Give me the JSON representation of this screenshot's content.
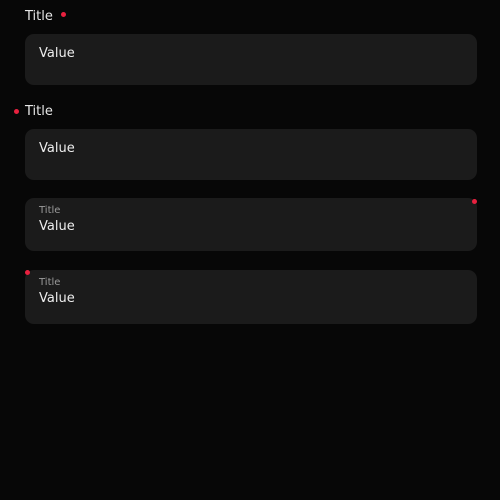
{
  "fields": [
    {
      "title": "Title",
      "value": "Value",
      "required": true,
      "layout": "outside-label-dot-after"
    },
    {
      "title": "Title",
      "value": "Value",
      "required": true,
      "layout": "outside-label-dot-before"
    },
    {
      "title": "Title",
      "value": "Value",
      "required": true,
      "layout": "inside-label-dot-top-right"
    },
    {
      "title": "Title",
      "value": "Value",
      "required": true,
      "layout": "inside-label-dot-top-left"
    }
  ],
  "colors": {
    "background": "#070707",
    "field_background": "#1b1b1b",
    "required_dot": "#e8213f",
    "label_text": "#e6e6e6",
    "value_text": "#ededed",
    "inner_label_text": "#9a9a9a"
  }
}
